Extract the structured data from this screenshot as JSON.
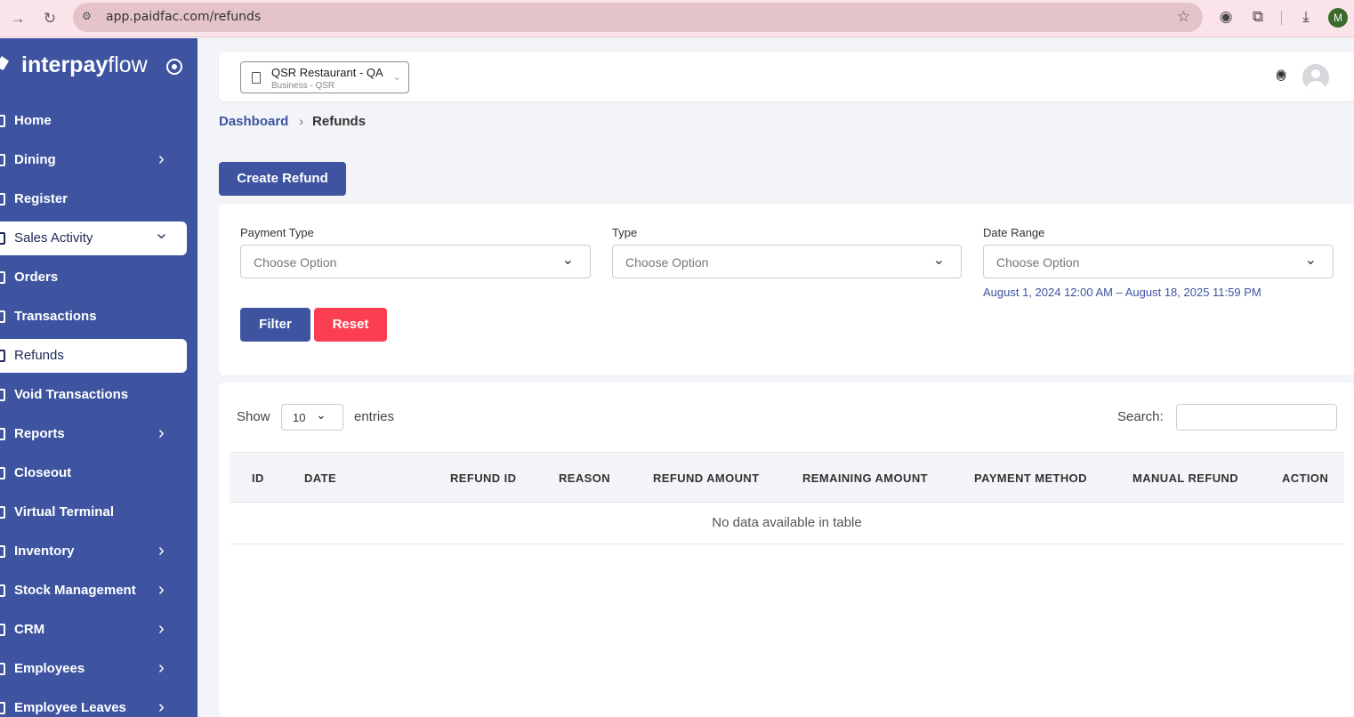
{
  "browser": {
    "url": "app.paidfac.com/refunds",
    "profile_initial": "M"
  },
  "brand": {
    "bold": "interpay",
    "light": "flow"
  },
  "sidebar": {
    "items": [
      {
        "label": "Home"
      },
      {
        "label": "Dining"
      },
      {
        "label": "Register"
      },
      {
        "label": "Sales Activity"
      },
      {
        "label": "Orders"
      },
      {
        "label": "Transactions"
      },
      {
        "label": "Refunds"
      },
      {
        "label": "Void Transactions"
      },
      {
        "label": "Reports"
      },
      {
        "label": "Closeout"
      },
      {
        "label": "Virtual Terminal"
      },
      {
        "label": "Inventory"
      },
      {
        "label": "Stock Management"
      },
      {
        "label": "CRM"
      },
      {
        "label": "Employees"
      },
      {
        "label": "Employee Leaves"
      }
    ]
  },
  "business": {
    "name": "QSR Restaurant - QA",
    "subtitle": "Business - QSR"
  },
  "breadcrumb": {
    "parent": "Dashboard",
    "current": "Refunds"
  },
  "actions": {
    "create_refund": "Create Refund",
    "filter": "Filter",
    "reset": "Reset"
  },
  "filters": {
    "payment_type": {
      "label": "Payment Type",
      "placeholder": "Choose Option"
    },
    "type": {
      "label": "Type",
      "placeholder": "Choose Option"
    },
    "date_range": {
      "label": "Date Range",
      "placeholder": "Choose Option",
      "hint": "August 1, 2024 12:00 AM – August 18, 2025 11:59 PM"
    }
  },
  "table": {
    "show_label": "Show",
    "page_size": "10",
    "entries_label": "entries",
    "search_label": "Search:",
    "columns": [
      "ID",
      "DATE",
      "REFUND ID",
      "REASON",
      "REFUND AMOUNT",
      "REMAINING AMOUNT",
      "PAYMENT METHOD",
      "MANUAL REFUND",
      "ACTION"
    ],
    "empty_message": "No data available in table"
  },
  "colors": {
    "primary": "#3e54a0",
    "danger": "#fb3e51",
    "chrome": "#fbe4e9"
  }
}
